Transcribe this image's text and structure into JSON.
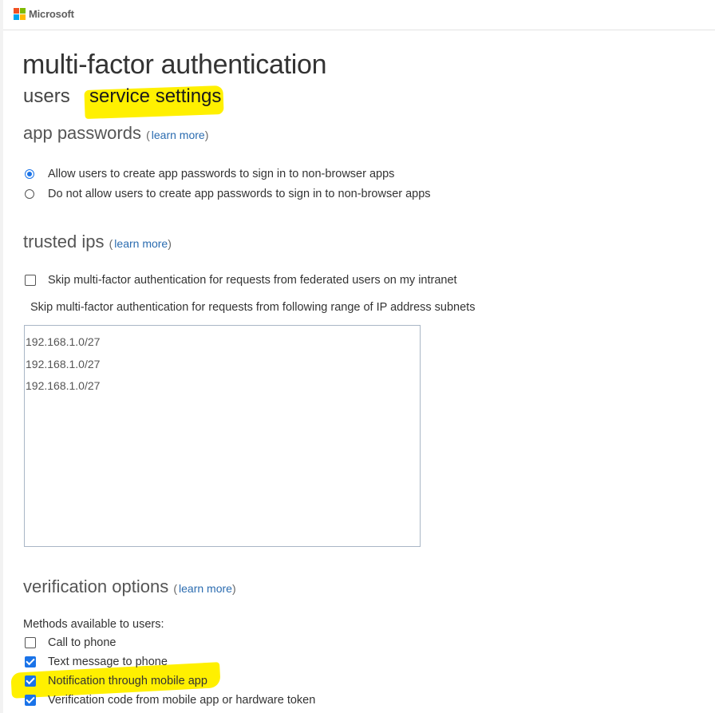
{
  "header": {
    "brand": "Microsoft",
    "logo_colors": [
      "#f25022",
      "#7fba00",
      "#00a4ef",
      "#ffb900"
    ]
  },
  "page": {
    "title": "multi-factor authentication",
    "tabs": [
      {
        "label": "users"
      },
      {
        "label": "service settings"
      }
    ]
  },
  "app_passwords": {
    "title": "app passwords",
    "learn_more": "learn more",
    "options": [
      {
        "label": "Allow users to create app passwords to sign in to non-browser apps",
        "selected": true
      },
      {
        "label": "Do not allow users to create app passwords to sign in to non-browser apps",
        "selected": false
      }
    ]
  },
  "trusted_ips": {
    "title": "trusted ips",
    "learn_more": "learn more",
    "skip_federated": {
      "label": "Skip multi-factor authentication for requests from federated users on my intranet",
      "checked": false
    },
    "subnets_label": "Skip multi-factor authentication for requests from following range of IP address subnets",
    "subnets": [
      "192.168.1.0/27",
      "192.168.1.0/27",
      "192.168.1.0/27"
    ]
  },
  "verification": {
    "title": "verification options",
    "learn_more": "learn more",
    "methods_label": "Methods available to users:",
    "methods": [
      {
        "label": "Call to phone",
        "checked": false
      },
      {
        "label": "Text message to phone",
        "checked": true
      },
      {
        "label": "Notification through mobile app",
        "checked": true
      },
      {
        "label": "Verification code from mobile app or hardware token",
        "checked": true
      }
    ]
  },
  "colors": {
    "accent": "#1a73e8",
    "highlight": "#fff000",
    "link": "#2b6cb0"
  }
}
